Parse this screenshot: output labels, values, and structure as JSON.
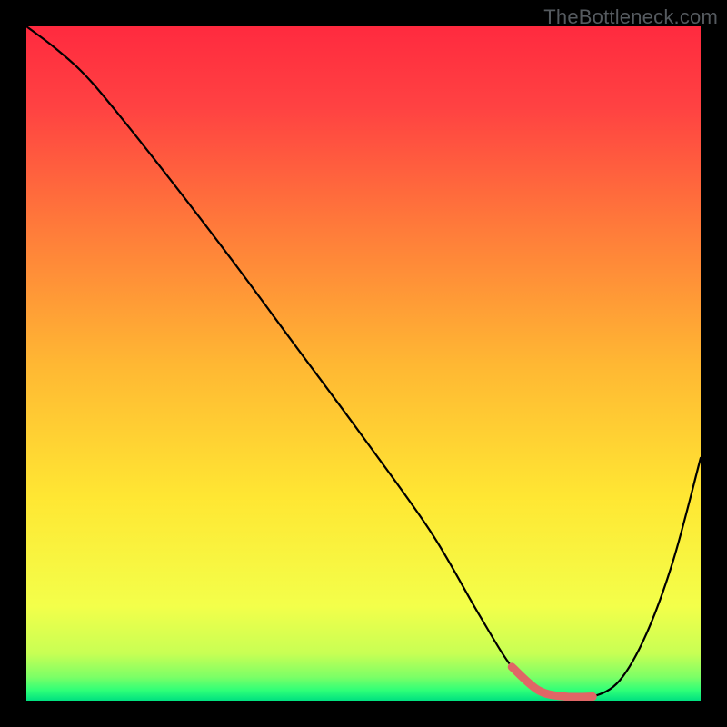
{
  "watermark": "TheBottleneck.com",
  "chart_data": {
    "type": "line",
    "title": "",
    "xlabel": "",
    "ylabel": "",
    "xlim": [
      0,
      100
    ],
    "ylim": [
      0,
      100
    ],
    "series": [
      {
        "name": "curve",
        "x": [
          0,
          4,
          8,
          12,
          20,
          30,
          40,
          50,
          60,
          67,
          72,
          76,
          80,
          84,
          88,
          92,
          96,
          100
        ],
        "y": [
          100,
          97,
          93.5,
          89,
          79,
          66,
          52.5,
          39,
          25,
          13,
          5,
          1.5,
          0.6,
          0.6,
          3,
          10,
          21,
          36
        ]
      }
    ],
    "highlight": {
      "name": "bottleneck-range",
      "x": [
        72,
        76,
        80,
        84
      ],
      "y": [
        5,
        1.5,
        0.6,
        0.6
      ]
    },
    "gradient_stops": [
      {
        "offset": 0.0,
        "color": "#ff2a3f"
      },
      {
        "offset": 0.12,
        "color": "#ff4242"
      },
      {
        "offset": 0.3,
        "color": "#ff7b3a"
      },
      {
        "offset": 0.5,
        "color": "#ffb733"
      },
      {
        "offset": 0.7,
        "color": "#ffe733"
      },
      {
        "offset": 0.86,
        "color": "#f3ff4a"
      },
      {
        "offset": 0.93,
        "color": "#c8ff54"
      },
      {
        "offset": 0.965,
        "color": "#7cff66"
      },
      {
        "offset": 0.985,
        "color": "#2eff78"
      },
      {
        "offset": 1.0,
        "color": "#00e080"
      }
    ]
  }
}
